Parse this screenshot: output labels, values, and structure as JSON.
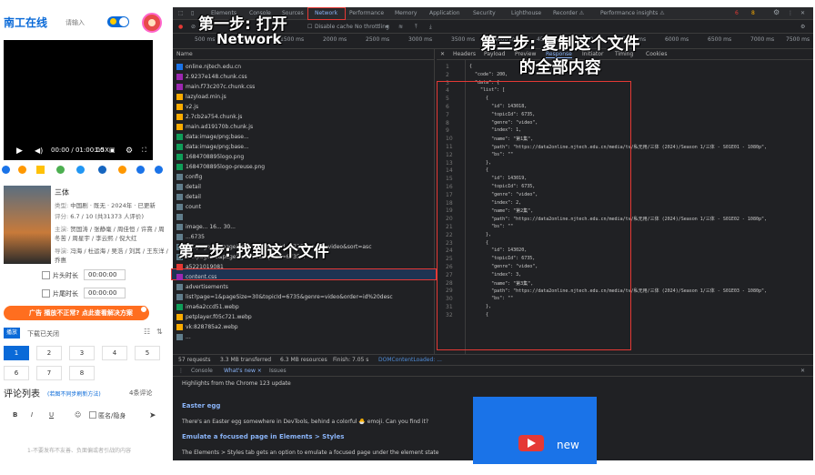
{
  "left": {
    "logo": "南工在线",
    "input_placeholder": "请输入",
    "video": {
      "time": "00:00 / 01:00:00",
      "speed": "1.5X"
    },
    "movie": {
      "title": "三体",
      "lines": [
        {
          "k": "类型:",
          "v": "中国剧 · 既无 · 2024年 · 已更新"
        },
        {
          "k": "评分:",
          "v": "6.7 / 10 (共31373 人评价)"
        },
        {
          "k": "主演:",
          "v": "贺国涛 / 张静毫 / 周佳恒 / 许熹 / 周冬苦 / 周星宇 / 李云熙 / 倪大红"
        },
        {
          "k": "导演:",
          "v": "冯海 / 杜运海 / 吴浩 / 刘其 / 王东洋 / 乔惠"
        }
      ]
    },
    "skip_intro": "片头时长",
    "skip_outro": "片尾时长",
    "time_intro": "00:00:00",
    "time_outro": "00:00:00",
    "ad": "广告  播放不正常? 点此查看解决方案",
    "tab_label": "播放",
    "tab_sub": "下载已关闭",
    "episodes": [
      "1",
      "2",
      "3",
      "4",
      "5",
      "6",
      "7",
      "8"
    ],
    "comments_title": "评论列表",
    "comments_hint": "(若图不同步刷新方法)",
    "comments_count": "4条评论",
    "toolbar": [
      "B",
      "I",
      "U"
    ],
    "anonymous": "匿名/隐身",
    "comment_placeholder": "1-不要发布不友善、负面偏或者引战的内容"
  },
  "devtools": {
    "tabs": [
      "Elements",
      "Console",
      "Sources",
      "Network",
      "Performance",
      "Memory",
      "Application",
      "Security",
      "Lighthouse",
      "Recorder ⚠",
      "Performance insights ⚠"
    ],
    "badges": {
      "errors": "6",
      "warnings": "8"
    },
    "controls": [
      "Disable cache",
      "No throttling"
    ],
    "timeline": [
      "500 ms",
      "1000 ms",
      "1500 ms",
      "2000 ms",
      "2500 ms",
      "3000 ms",
      "3500 ms",
      "4000 ms",
      "4500 ms",
      "5000 ms",
      "5500 ms",
      "6000 ms",
      "6500 ms",
      "7000 ms",
      "7500 ms"
    ],
    "name_header": "Name",
    "files": [
      {
        "name": "online.njtech.edu.cn",
        "c": "#1a73e8"
      },
      {
        "name": "2.9237e148.chunk.css",
        "c": "#9c27b0"
      },
      {
        "name": "main.f73c207c.chunk.css",
        "c": "#9c27b0"
      },
      {
        "name": "lazyload.min.js",
        "c": "#f9ab00"
      },
      {
        "name": "v2.js",
        "c": "#f9ab00"
      },
      {
        "name": "2.7cb2a754.chunk.js",
        "c": "#f9ab00"
      },
      {
        "name": "main.ad19170b.chunk.js",
        "c": "#f9ab00"
      },
      {
        "name": "data:image/png;base...",
        "c": "#0f9d58"
      },
      {
        "name": "data:image/png;base...",
        "c": "#0f9d58"
      },
      {
        "name": "1684708895logo.png",
        "c": "#0f9d58"
      },
      {
        "name": "1684708895logo-preuse.png",
        "c": "#0f9d58"
      },
      {
        "name": "config",
        "c": "#607d8b"
      },
      {
        "name": "detail",
        "c": "#607d8b"
      },
      {
        "name": "detail",
        "c": "#607d8b"
      },
      {
        "name": "count",
        "c": "#607d8b"
      },
      {
        "name": "",
        "c": "#607d8b"
      },
      {
        "name": "image... 16... 30...",
        "c": "#607d8b"
      },
      {
        "name": "...6735",
        "c": "#607d8b"
      },
      {
        "name": "list?page=1&pageSize=400&topicId=6735&genre=video&sort=asc",
        "c": "#607d8b"
      },
      {
        "name": "list?page=1&pageSize=30&topicId=6735...",
        "c": "#607d8b"
      },
      {
        "name": "a5221019081",
        "c": "#e53935"
      },
      {
        "name": "content.css",
        "c": "#9c27b0"
      },
      {
        "name": "advertisements",
        "c": "#607d8b"
      },
      {
        "name": "list?page=1&pageSize=30&topicId=6735&genre=video&order=id%20desc",
        "c": "#607d8b"
      },
      {
        "name": "ima6a2ccd51.webp",
        "c": "#0f9d58"
      },
      {
        "name": "petplayer.f05c721.webp",
        "c": "#f9ab00"
      },
      {
        "name": "vk:828785a2.webp",
        "c": "#f9ab00"
      },
      {
        "name": "...",
        "c": "#607d8b"
      }
    ],
    "resp_tabs": [
      "Headers",
      "Payload",
      "Preview",
      "Response",
      "Initiator",
      "Timing",
      "Cookies"
    ],
    "code": [
      "{",
      "  \"code\": 200,",
      "  \"data\": {",
      "    \"list\": [",
      "      {",
      "        \"id\": 143018,",
      "        \"topicId\": 6735,",
      "        \"genre\": \"video\",",
      "        \"index\": 1,",
      "        \"name\": \"第1集\",",
      "        \"path\": \"https://data2online.njtech.edu.cn/media/tv/私无用/三体 (2024)/Season 1/三体 - S01E01 - 1080p\",",
      "        \"bs\": \"\"",
      "      },",
      "      {",
      "        \"id\": 143019,",
      "        \"topicId\": 6735,",
      "        \"genre\": \"video\",",
      "        \"index\": 2,",
      "        \"name\": \"第2集\",",
      "        \"path\": \"https://data2online.njtech.edu.cn/media/tv/私无用/三体 (2024)/Season 1/三体 - S01E02 - 1080p\",",
      "        \"bs\": \"\"",
      "      },",
      "      {",
      "        \"id\": 143020,",
      "        \"topicId\": 6735,",
      "        \"genre\": \"video\",",
      "        \"index\": 3,",
      "        \"name\": \"第3集\",",
      "        \"path\": \"https://data2online.njtech.edu.cn/media/tv/私无用/三体 (2024)/Season 1/三体 - S01E03 - 1080p\",",
      "        \"bs\": \"\"",
      "      },",
      "      {"
    ],
    "status": [
      "57 requests",
      "3.3 MB transferred",
      "6.3 MB resources",
      "Finish: 7.05 s",
      "DOMContentLoaded: ..."
    ],
    "drawer_tabs": [
      "Console",
      "What's new ×",
      "Issues"
    ],
    "drawer": {
      "h1": "Highlights from the Chrome 123 update",
      "h2": "Easter egg",
      "p2": "There's an Easter egg somewhere in DevTools, behind a colorful 🐣 emoji. Can you find it?",
      "h3": "Emulate a focused page in Elements > Styles",
      "p3": "The Elements > Styles tab gets an option to emulate a focused page under the element state",
      "promo": "new"
    }
  },
  "annotations": {
    "step1_a": "第一步: 打开",
    "step1_b": "Network",
    "step2": "第二步: 找到这个文件",
    "step3_a": "第三步: 复制这个文件",
    "step3_b": "的全部内容"
  }
}
